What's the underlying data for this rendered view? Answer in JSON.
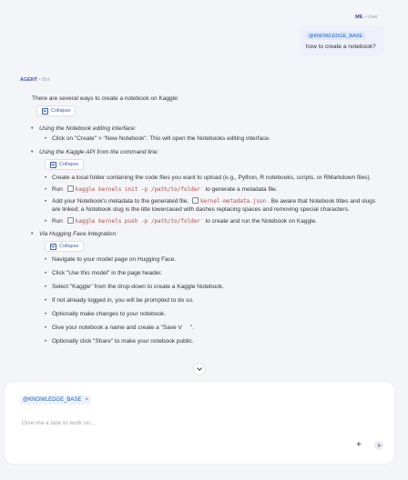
{
  "user_msg": {
    "me_label": "ME",
    "role": "User",
    "chip": "@KNOWLEDGE_BASE",
    "text": "how to create a notebook?"
  },
  "agent": {
    "label": "AGENT",
    "role": "Bot",
    "intro": "There are several ways to create a notebook on Kaggle:",
    "collapse_label": "Collapse",
    "sections": [
      {
        "title": "Using the Notebook editing interface:",
        "items": [
          "Click on \"Create\" > \"New Notebook\". This will open the Notebooks editing interface."
        ]
      },
      {
        "title": "Using the Kaggle API from the command line:",
        "items": [
          "Create a local folder containing the code files you want to upload (e.g., Python, R notebooks, scripts, or RMarkdown files).",
          "Run",
          "Add your Notebook's metadata to the generated file,",
          "Run"
        ],
        "code1": "kaggle kernels init -p /path/to/folder",
        "after1": "to generate a metadata file.",
        "code2": "kernel-metadata.json",
        "after2": ". Be aware that Notebook titles and slugs are linked; a Notebook slug is the title lowercased with dashes replacing spaces and removing special characters.",
        "code3": "kaggle kernels push -p /path/to/folder",
        "after3": "to create and run the Notebook on Kaggle."
      },
      {
        "title": "Via Hugging Face Integration:",
        "items": [
          "Navigate to your model page on Hugging Face.",
          "Click \"Use this model\" in the page header.",
          "Select \"Kaggle\" from the drop-down to create a Kaggle Notebook.",
          "If not already logged in, you will be prompted to do so.",
          "Optionally make changes to your notebook.",
          "Give your notebook a name and create a \"Save V",
          "Optionally click \"Share\" to make your notebook public."
        ],
        "item6_tail": "\"."
      }
    ]
  },
  "composer": {
    "chip": "@KNOWLEDGE_BASE",
    "chip_close": "×",
    "placeholder": "Give me a task to work on...",
    "plus": "+"
  }
}
